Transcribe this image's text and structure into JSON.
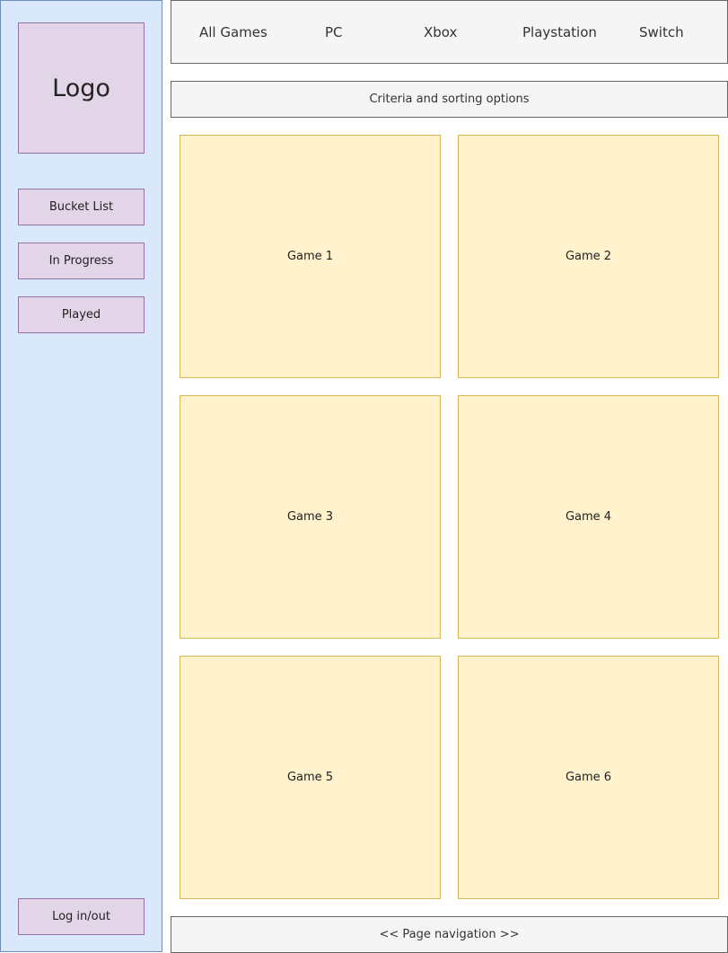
{
  "sidebar": {
    "logo": "Logo",
    "items": [
      {
        "label": "Bucket List"
      },
      {
        "label": "In Progress"
      },
      {
        "label": "Played"
      }
    ],
    "auth_label": "Log in/out"
  },
  "topnav": {
    "items": [
      {
        "label": "All Games"
      },
      {
        "label": "PC"
      },
      {
        "label": "Xbox"
      },
      {
        "label": "Playstation"
      },
      {
        "label": "Switch"
      }
    ]
  },
  "criteria": {
    "label": "Criteria and sorting options"
  },
  "games": [
    {
      "label": "Game 1"
    },
    {
      "label": "Game 2"
    },
    {
      "label": "Game 3"
    },
    {
      "label": "Game 4"
    },
    {
      "label": "Game 5"
    },
    {
      "label": "Game 6"
    }
  ],
  "pagination": {
    "label": "<< Page navigation >>"
  },
  "colors": {
    "sidebar_fill": "#dae8fc",
    "sidebar_stroke": "#6c8ebf",
    "button_fill": "#e1d5e7",
    "button_stroke": "#9673a6",
    "bar_fill": "#f5f5f5",
    "bar_stroke": "#666666",
    "tile_fill": "#fff2cc",
    "tile_stroke": "#d6b656"
  }
}
